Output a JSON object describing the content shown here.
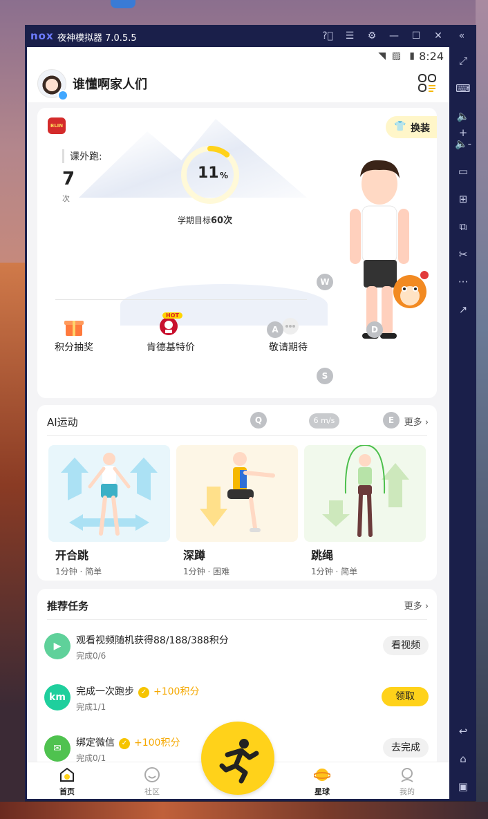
{
  "window": {
    "logo": "nox",
    "title": "夜神模拟器 7.0.5.5",
    "controls": [
      "help-icon",
      "menu-icon",
      "gear-icon",
      "minimize-icon",
      "maximize-icon",
      "close-icon",
      "collapse-icon"
    ]
  },
  "sidebar": {
    "tools": [
      "fullscreen-icon",
      "keyboard-icon",
      "volume-up-icon",
      "volume-down-icon",
      "screen-icon",
      "apk-icon",
      "multi-instance-icon",
      "scissors-icon",
      "more-icon",
      "share-icon",
      "back-icon",
      "home-icon",
      "recents-icon"
    ],
    "more_glyph": "···"
  },
  "status": {
    "time": "8:24"
  },
  "header": {
    "username": "谁懂啊家人们"
  },
  "hero": {
    "badge_text": "BLIN",
    "dress_label": "换装",
    "run_label": "课外跑:",
    "run_count": "7",
    "run_unit": "次",
    "progress_percent": "11",
    "progress_fraction": 0.11,
    "percent_sign": "%",
    "goal_prefix": "学期目标",
    "goal_value": "60次",
    "features": [
      {
        "label": "积分抽奖"
      },
      {
        "label": "肯德基特价",
        "tag": "HOT"
      },
      {
        "label": "敬请期待"
      }
    ],
    "keys": {
      "w": "W",
      "a": "A",
      "s": "S",
      "d": "D",
      "q": "Q",
      "e": "E"
    }
  },
  "ai_section": {
    "title": "AI运动",
    "more": "更多",
    "speed": "6 m/s",
    "exercises": [
      {
        "name": "开合跳",
        "meta": "1分钟 · 简单"
      },
      {
        "name": "深蹲",
        "meta": "1分钟 · 困难"
      },
      {
        "name": "跳绳",
        "meta": "1分钟 · 简单"
      }
    ]
  },
  "tasks_section": {
    "title": "推荐任务",
    "more": "更多",
    "tasks": [
      {
        "title": "观看视频随机获得88/188/388积分",
        "sub": "完成0/6",
        "points": "",
        "button": "看视频",
        "icon_text": ""
      },
      {
        "title": "完成一次跑步",
        "sub": "完成1/1",
        "points": "+100积分",
        "button": "领取",
        "icon_text": "km"
      },
      {
        "title": "绑定微信",
        "sub": "完成0/1",
        "points": "+100积分",
        "button": "去完成",
        "icon_text": ""
      }
    ]
  },
  "nav": {
    "items": [
      {
        "label": "首页"
      },
      {
        "label": "社区"
      },
      {
        "label": "星球"
      },
      {
        "label": "我的"
      }
    ]
  },
  "colors": {
    "accent": "#ffd21a",
    "progress": "#ffd21a",
    "points": "#f5a800"
  }
}
